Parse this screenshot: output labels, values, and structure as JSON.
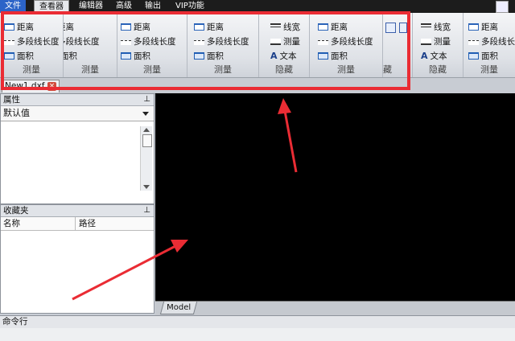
{
  "menubar": {
    "tabs": [
      "文件",
      "查看器",
      "编辑器",
      "高级",
      "输出",
      "VIP功能"
    ]
  },
  "ribbon": {
    "measure_items": [
      "距离",
      "多段线长度",
      "面积"
    ],
    "measure_items_clipped": [
      "距离",
      "多段线长度",
      "面积"
    ],
    "group_measure": "测量",
    "hide_items": [
      "线宽",
      "测量",
      "文本"
    ],
    "group_hide": "隐藏",
    "clipped_label": "藏"
  },
  "tabs": {
    "doc_name": "New1.dxf",
    "close_glyph": "×"
  },
  "properties": {
    "title": "属性",
    "pin": "⊥",
    "dropdown_value": "默认值"
  },
  "favorites": {
    "title": "收藏夹",
    "pin": "⊥",
    "col_name": "名称",
    "col_path": "路径"
  },
  "model_tab": "Model",
  "command_line": "命令行",
  "colors": {
    "highlight": "#ea2c34",
    "canvas": "#000000",
    "menubar": "#1c1c1c",
    "file_tab": "#2c64c8"
  }
}
